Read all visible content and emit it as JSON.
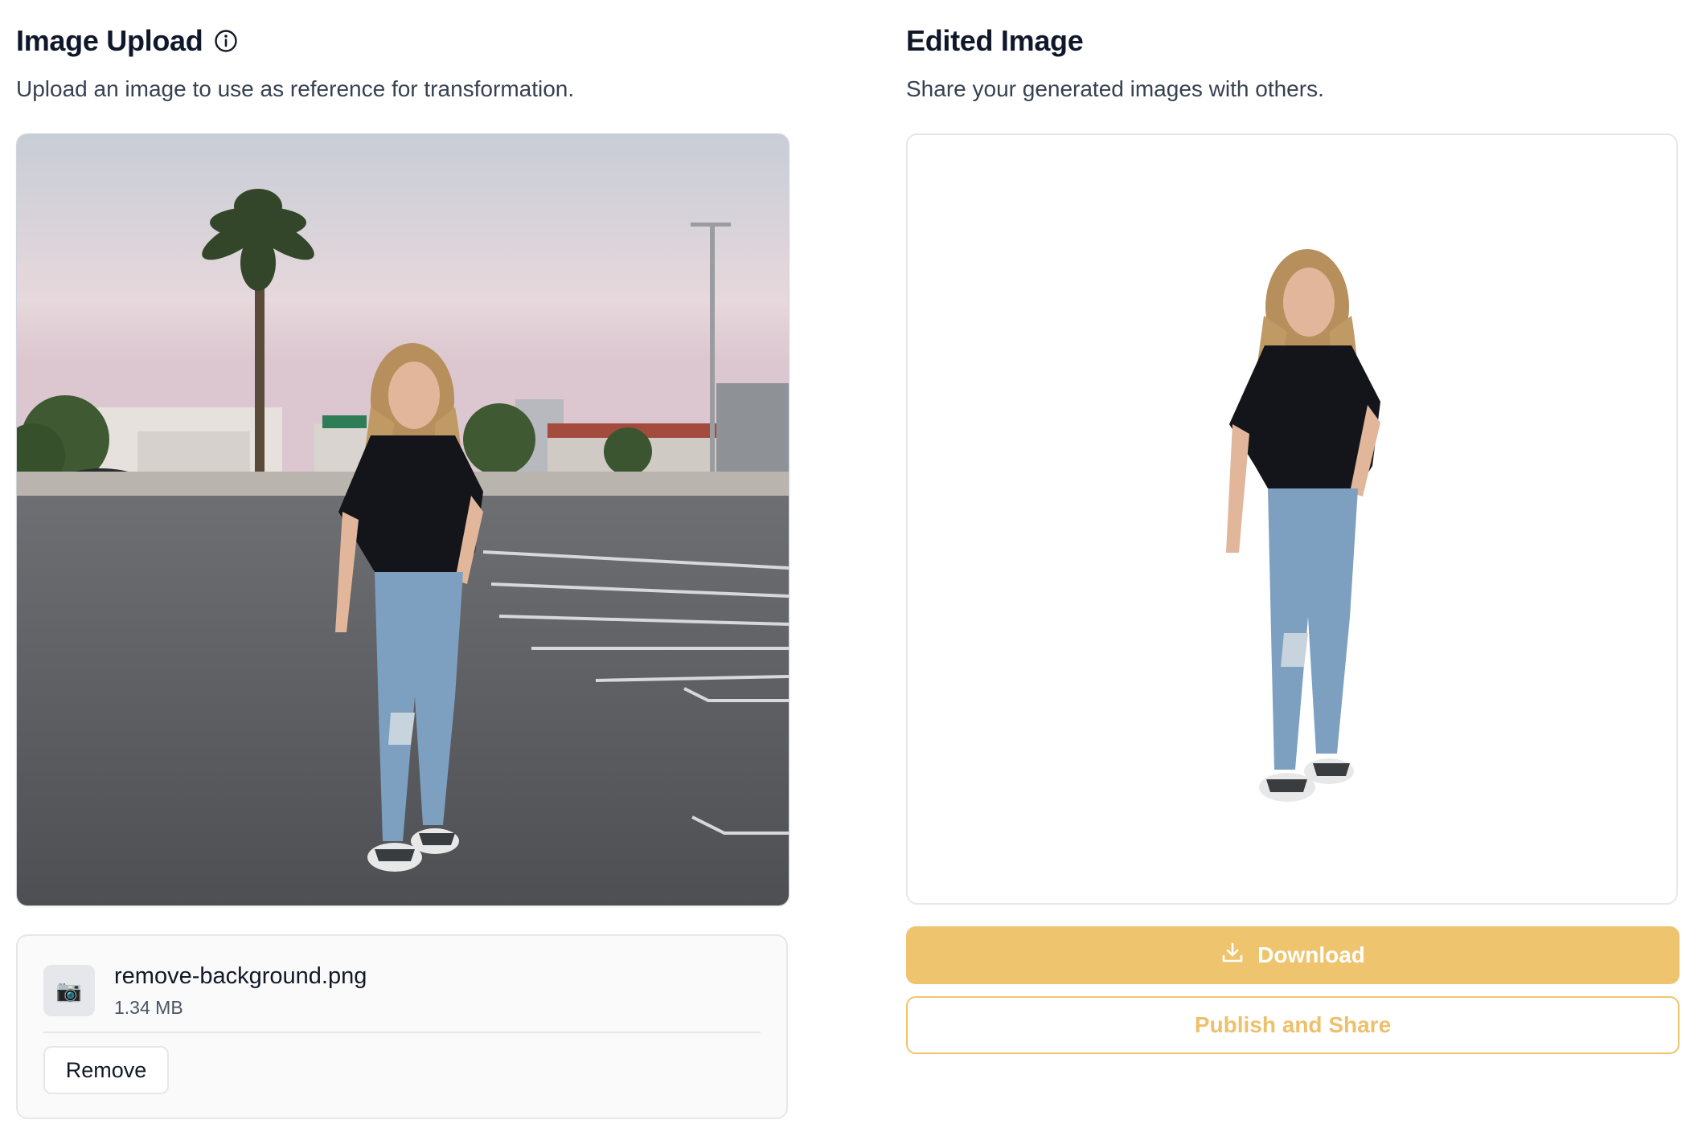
{
  "upload_panel": {
    "title": "Image Upload",
    "info_icon": "info-circle-icon",
    "description": "Upload an image to use as reference for transformation."
  },
  "file": {
    "thumb_icon": "camera-icon",
    "thumb_glyph": "📷",
    "name": "remove-background.png",
    "size": "1.34 MB",
    "remove_label": "Remove"
  },
  "result_panel": {
    "title": "Edited Image",
    "description": "Share your generated images with others.",
    "download_label": "Download",
    "download_icon": "download-icon",
    "publish_label": "Publish and Share"
  },
  "colors": {
    "accent": "#efc46f",
    "accent_text": "#eec06c"
  }
}
